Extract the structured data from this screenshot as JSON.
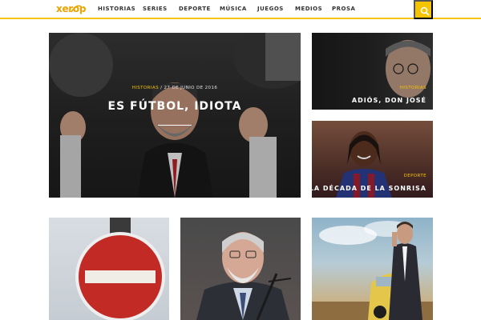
{
  "site": {
    "logo_text": "xerop",
    "accent_color": "#f5c400"
  },
  "nav": {
    "items": [
      {
        "label": "HISTORIAS"
      },
      {
        "label": "SERIES"
      },
      {
        "label": "DEPORTE"
      },
      {
        "label": "MÚSICA"
      },
      {
        "label": "JUEGOS"
      },
      {
        "label": "MEDIOS"
      },
      {
        "label": "PROSA"
      }
    ],
    "search_icon": "search-icon"
  },
  "articles": {
    "featured": {
      "category": "HISTORIAS",
      "separator": " / ",
      "date": "27 DE JUNIO DE 2016",
      "title": "ES FÚTBOL, IDIOTA"
    },
    "side": [
      {
        "category": "HISTORIAS",
        "title": "ADIÓS, DON JOSÉ"
      },
      {
        "category": "DEPORTE",
        "title": "LA DÉCADA DE LA SONRISA"
      }
    ],
    "grid": [
      {
        "image": "no-entry-sign"
      },
      {
        "image": "man-with-microphone"
      },
      {
        "image": "man-on-phone-with-car"
      }
    ]
  }
}
